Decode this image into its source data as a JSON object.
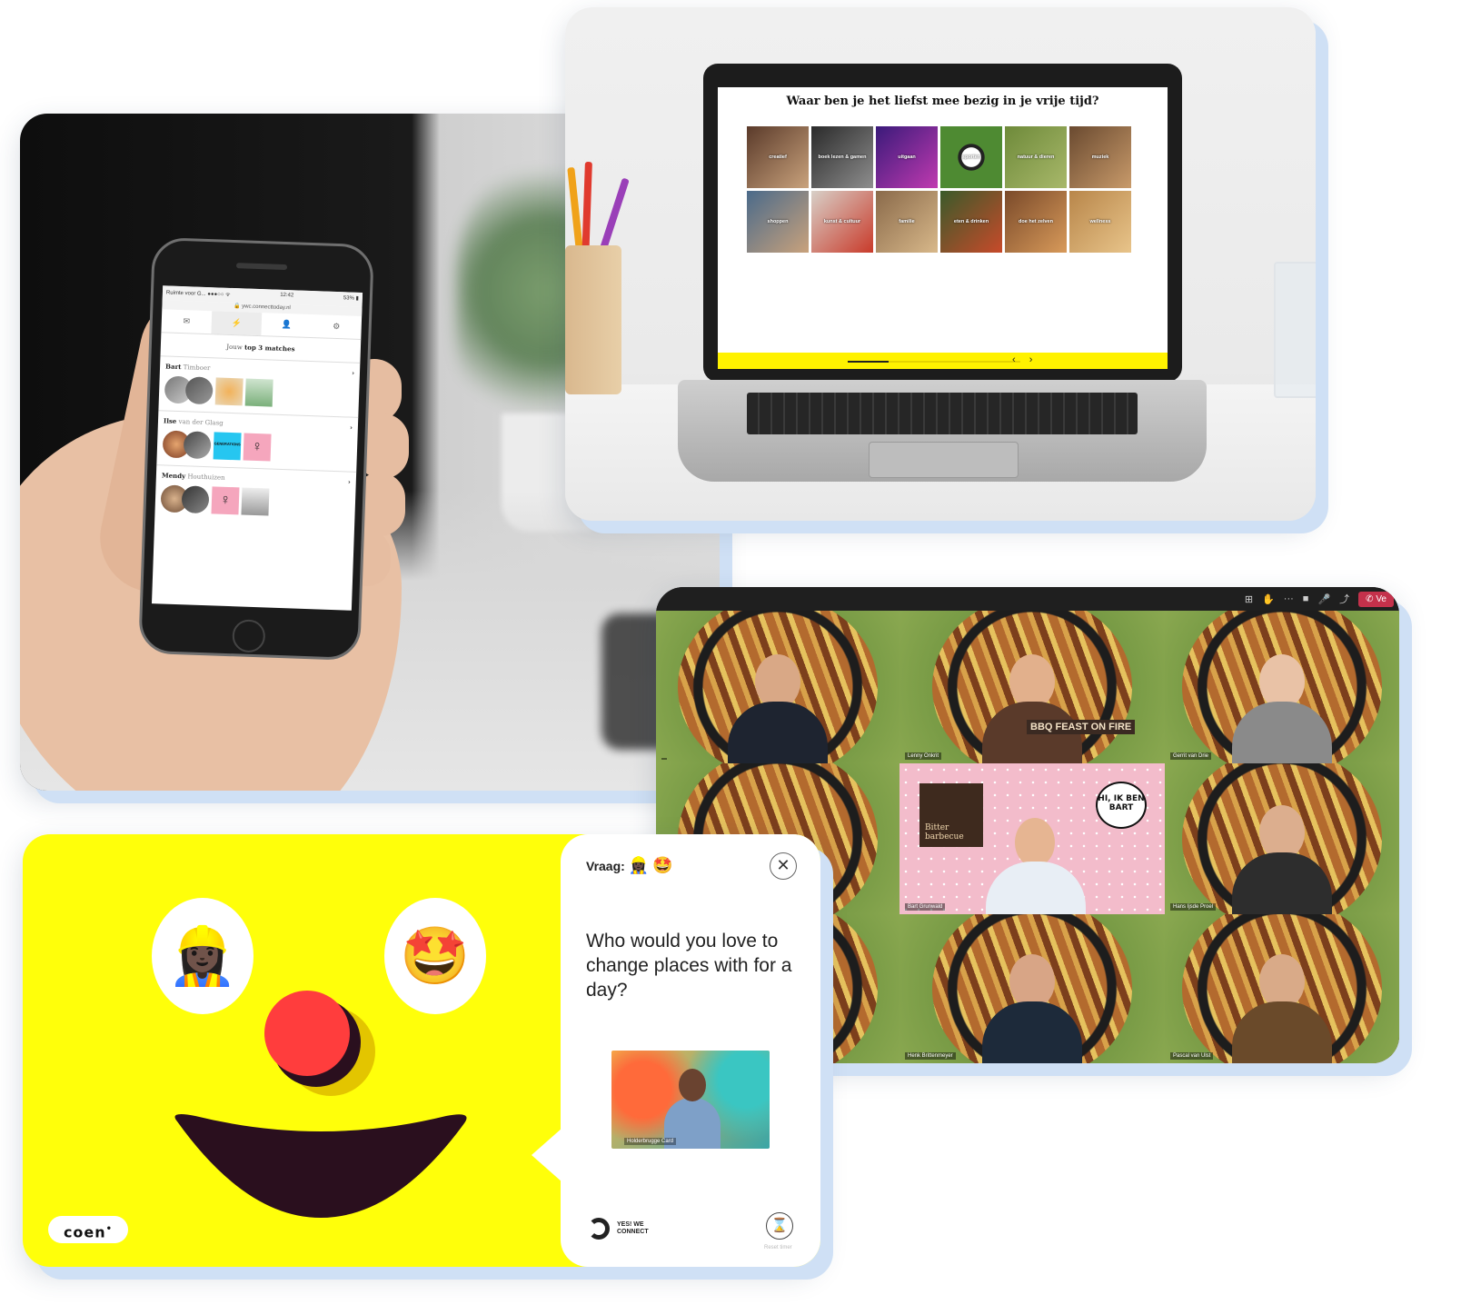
{
  "phone_app": {
    "status_left": "Ruimte voor G... ●●●○○ ᯤ",
    "status_time": "12:42",
    "status_battery": "53% ▮",
    "url": "🔒 ywc.connecttoday.nl",
    "tabs": [
      "✉",
      "⚡",
      "👤",
      "⚙"
    ],
    "heading_prefix": "Jouw",
    "heading_bold": "top 3 matches",
    "matches": [
      {
        "first": "Bart",
        "last": "Timboer",
        "chevron": "›"
      },
      {
        "first": "Ilse",
        "last": "van der Glasg",
        "chevron": "›"
      },
      {
        "first": "Mendy",
        "last": "Houthuizen",
        "chevron": "›"
      }
    ],
    "badge_text": "GENERATIONS"
  },
  "laptop_app": {
    "question": "Waar ben je het liefst mee bezig in je vrije tijd?",
    "tiles": [
      "creatief",
      "boek lezen & gamen",
      "uitgaan",
      "sporten",
      "natuur & dieren",
      "muziek",
      "shoppen",
      "kunst & cultuur",
      "familie",
      "eten & drinken",
      "doe het zelven",
      "wellness"
    ],
    "nav_arrows": "‹ ›"
  },
  "video_call": {
    "controls": [
      "⊞",
      "✋",
      "···",
      "■",
      "🎤",
      "⤴"
    ],
    "leave_label": "✆ Ve",
    "participants": [
      "",
      "Lenny Onkrit",
      "Gerrit van Drie",
      "",
      "Bart Grunwald",
      "Hans Ijsde Proel",
      "",
      "Henk Brittenmeyer",
      "Pascal van Ulst"
    ],
    "speech_bubble": "HI, IK BEN BART",
    "book_title": "Bitter barbecue",
    "book_banner": "BBQ FEAST ON FIRE"
  },
  "conversation_card": {
    "eye_left_icon": "👷🏿‍♀️",
    "eye_right_icon": "🤩",
    "brand_badge": "coen",
    "brand_badge_mark": "•",
    "vraag_label": "Vraag:",
    "vraag_icons": [
      "👷🏿‍♀️",
      "🤩"
    ],
    "close_icon": "✕",
    "question": "Who would you love to change places with for a day?",
    "video_name": "Holderbrugge Card",
    "footer_logo_text": "YES! WE CONNECT",
    "timer_icon": "⌛",
    "timer_label": "Reset timer"
  }
}
